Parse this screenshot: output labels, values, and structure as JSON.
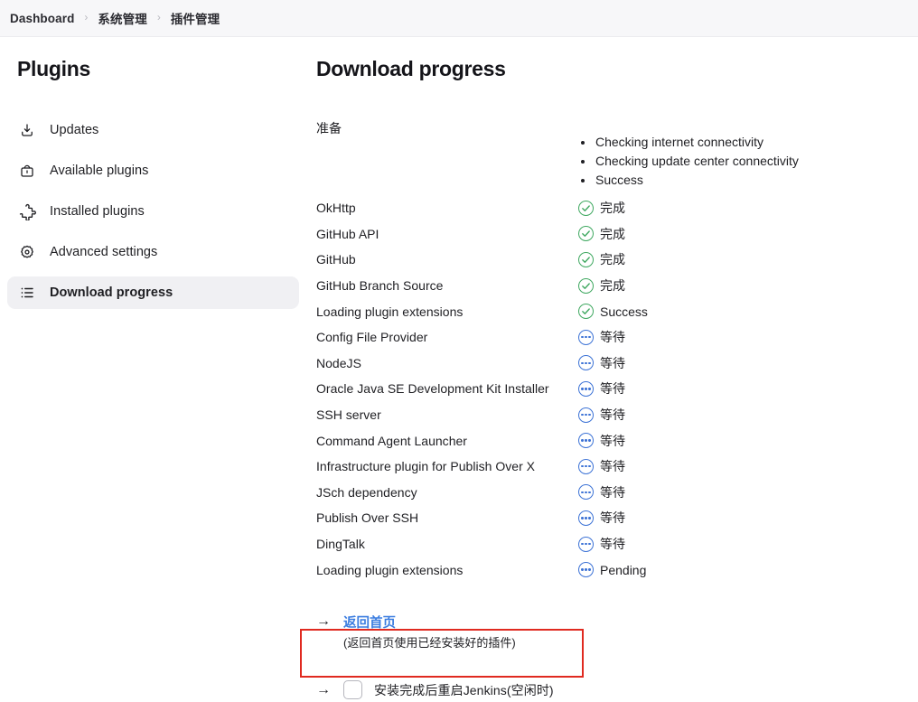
{
  "breadcrumb": {
    "items": [
      {
        "label": "Dashboard"
      },
      {
        "label": "系统管理"
      },
      {
        "label": "插件管理"
      }
    ],
    "separator": "›"
  },
  "sidebar": {
    "title": "Plugins",
    "items": [
      {
        "label": "Updates",
        "icon": "download-icon",
        "active": false
      },
      {
        "label": "Available plugins",
        "icon": "bag-icon",
        "active": false
      },
      {
        "label": "Installed plugins",
        "icon": "puzzle-icon",
        "active": false
      },
      {
        "label": "Advanced settings",
        "icon": "gear-icon",
        "active": false
      },
      {
        "label": "Download progress",
        "icon": "list-icon",
        "active": true
      }
    ]
  },
  "main": {
    "title": "Download progress",
    "prepare": {
      "label": "准备",
      "steps": [
        "Checking internet connectivity",
        "Checking update center connectivity",
        "Success"
      ]
    },
    "plugins": [
      {
        "name": "OkHttp",
        "status": "完成",
        "state": "success"
      },
      {
        "name": "GitHub API",
        "status": "完成",
        "state": "success"
      },
      {
        "name": "GitHub",
        "status": "完成",
        "state": "success"
      },
      {
        "name": "GitHub Branch Source",
        "status": "完成",
        "state": "success"
      },
      {
        "name": "Loading plugin extensions",
        "status": "Success",
        "state": "success"
      },
      {
        "name": "Config File Provider",
        "status": "等待",
        "state": "pending"
      },
      {
        "name": "NodeJS",
        "status": "等待",
        "state": "pending"
      },
      {
        "name": "Oracle Java SE Development Kit Installer",
        "status": "等待",
        "state": "pending"
      },
      {
        "name": "SSH server",
        "status": "等待",
        "state": "pending"
      },
      {
        "name": "Command Agent Launcher",
        "status": "等待",
        "state": "pending"
      },
      {
        "name": "Infrastructure plugin for Publish Over X",
        "status": "等待",
        "state": "pending"
      },
      {
        "name": "JSch dependency",
        "status": "等待",
        "state": "pending"
      },
      {
        "name": "Publish Over SSH",
        "status": "等待",
        "state": "pending"
      },
      {
        "name": "DingTalk",
        "status": "等待",
        "state": "pending"
      },
      {
        "name": "Loading plugin extensions",
        "status": "Pending",
        "state": "pending"
      }
    ],
    "footer": {
      "arrow": "→",
      "home_link": "返回首页",
      "home_hint": "(返回首页使用已经安装好的插件)",
      "restart_label": "安装完成后重启Jenkins(空闲时)",
      "restart_checked": false
    }
  },
  "colors": {
    "success": "#3fa860",
    "pending": "#3d73d6",
    "link": "#3b7de0",
    "highlight_box": "#e02a20",
    "sidebar_active_bg": "#f0f0f3",
    "topbar_bg": "#f7f7f9"
  }
}
